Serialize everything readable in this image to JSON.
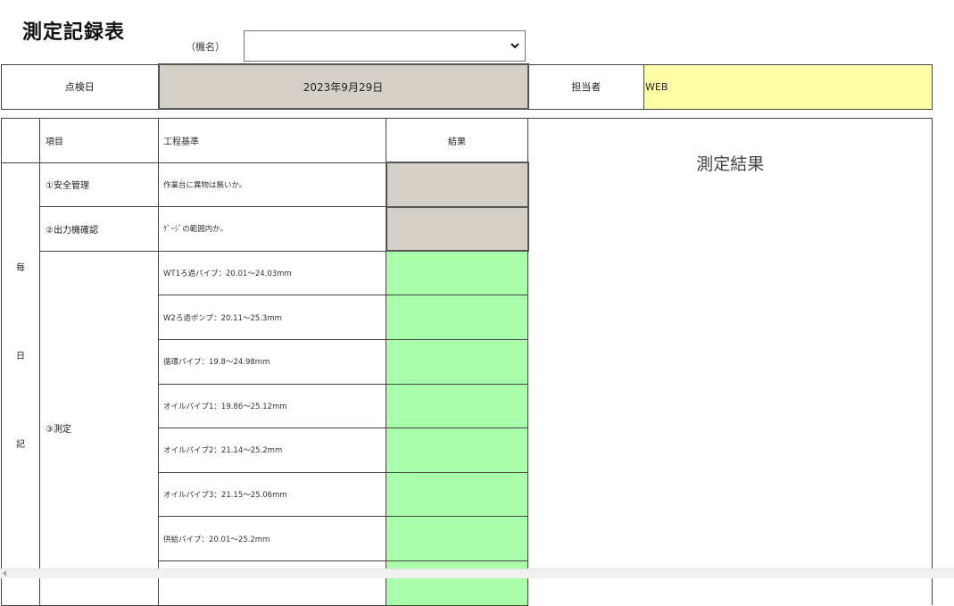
{
  "page": {
    "title": "測定記録表",
    "machine_label": "（機名）",
    "machine_select_value": ""
  },
  "header": {
    "date_label": "点検日",
    "date_value": "2023年9月29日",
    "staff_label": "担当者",
    "staff_value": "WEB"
  },
  "table": {
    "col_item": "項目",
    "col_standard": "工程基準",
    "col_result": "結果",
    "category_chars": [
      "毎",
      "日",
      "記"
    ],
    "rows": [
      {
        "item": "①安全管理",
        "standard": "作業台に異物は無いか。",
        "result": ""
      },
      {
        "item": "②出力機確認",
        "standard": "ｹﾞｰｼﾞの範囲内か。",
        "result": ""
      },
      {
        "item": "③測定",
        "standard": "WT1ろ過パイプ：20.01～24.03mm",
        "result": ""
      },
      {
        "item": "",
        "standard": "W2ろ過ポンプ：20.11～25.3mm",
        "result": ""
      },
      {
        "item": "",
        "standard": "循環パイプ：19.8～24.98mm",
        "result": ""
      },
      {
        "item": "",
        "standard": "オイルパイプ1：19.86～25.12mm",
        "result": ""
      },
      {
        "item": "",
        "standard": "オイルパイプ2：21.14～25.2mm",
        "result": ""
      },
      {
        "item": "",
        "standard": "オイルパイプ3：21.15～25.06mm",
        "result": ""
      },
      {
        "item": "",
        "standard": "供給パイプ：20.01～25.2mm",
        "result": ""
      },
      {
        "item": "",
        "standard": "",
        "result": ""
      }
    ],
    "panel_title": "測定結果"
  },
  "colors": {
    "readonly_gray": "#d4d0c8",
    "input_green": "#aaffaa",
    "input_yellow": "#ffffa8"
  }
}
